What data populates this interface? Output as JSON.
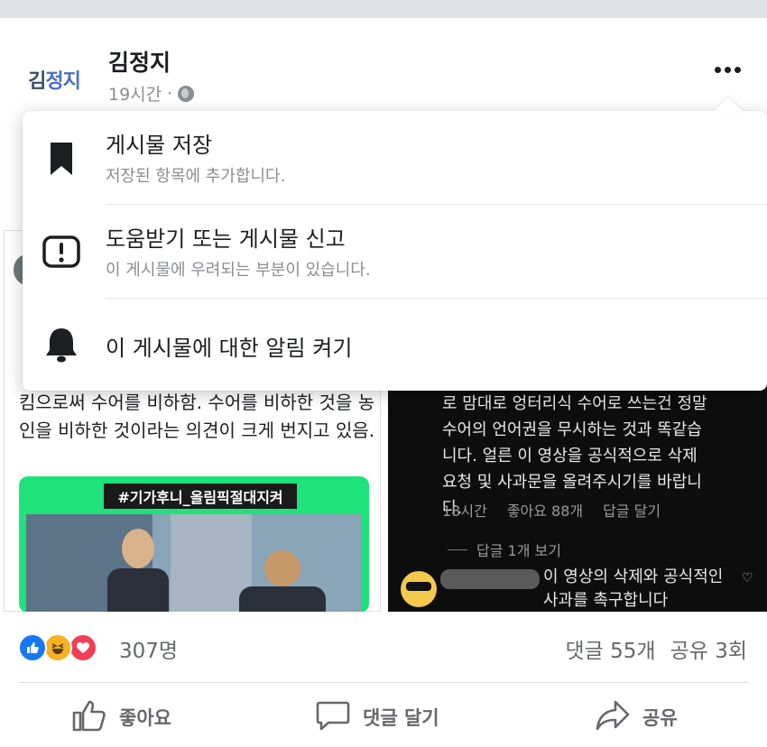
{
  "post": {
    "avatar_text_1": "김",
    "avatar_text_2": "정지",
    "author": "김정지",
    "time": "19시간",
    "separator": "·"
  },
  "menu": {
    "items": [
      {
        "title": "게시물 저장",
        "subtitle": "저장된 항목에 추가합니다.",
        "icon": "bookmark-icon"
      },
      {
        "title": "도움받기 또는 게시물 신고",
        "subtitle": "이 게시물에 우려되는 부분이 있습니다.",
        "icon": "report-icon"
      },
      {
        "title": "이 게시물에 대한 알림 켜기",
        "icon": "bell-icon"
      }
    ]
  },
  "background": {
    "left_text": "킴으로써 수어를 비하함. 수어를 비하한 것을 농인을 비하한 것이라는 의견이 크게 번지고 있음.",
    "hashtag": "#기가후니_올림픽절대지켜",
    "right_text": "로 맘대로 엉터리식 수어로 쓰는건 정말 수어의 언어권을 무시하는 것과 똑같습니다. 얼른 이 영상을 공식적으로 삭제 요청 및 사과문을 올려주시기를 바랍니다.",
    "comment_time": "18시간",
    "comment_likes": "좋아요 88개",
    "comment_reply": "답글 달기",
    "view_replies": "답글 1개 보기",
    "comment2_text": "이 영상의 삭제와 공식적인 사과를 촉구합니다"
  },
  "reactions": {
    "count": "307명",
    "comments": "댓글 55개",
    "shares": "공유 3회",
    "colors": {
      "like": "#1877f2",
      "haha": "#f7b125",
      "love": "#f33e58"
    }
  },
  "actions": {
    "like": "좋아요",
    "comment": "댓글 달기",
    "share": "공유"
  }
}
